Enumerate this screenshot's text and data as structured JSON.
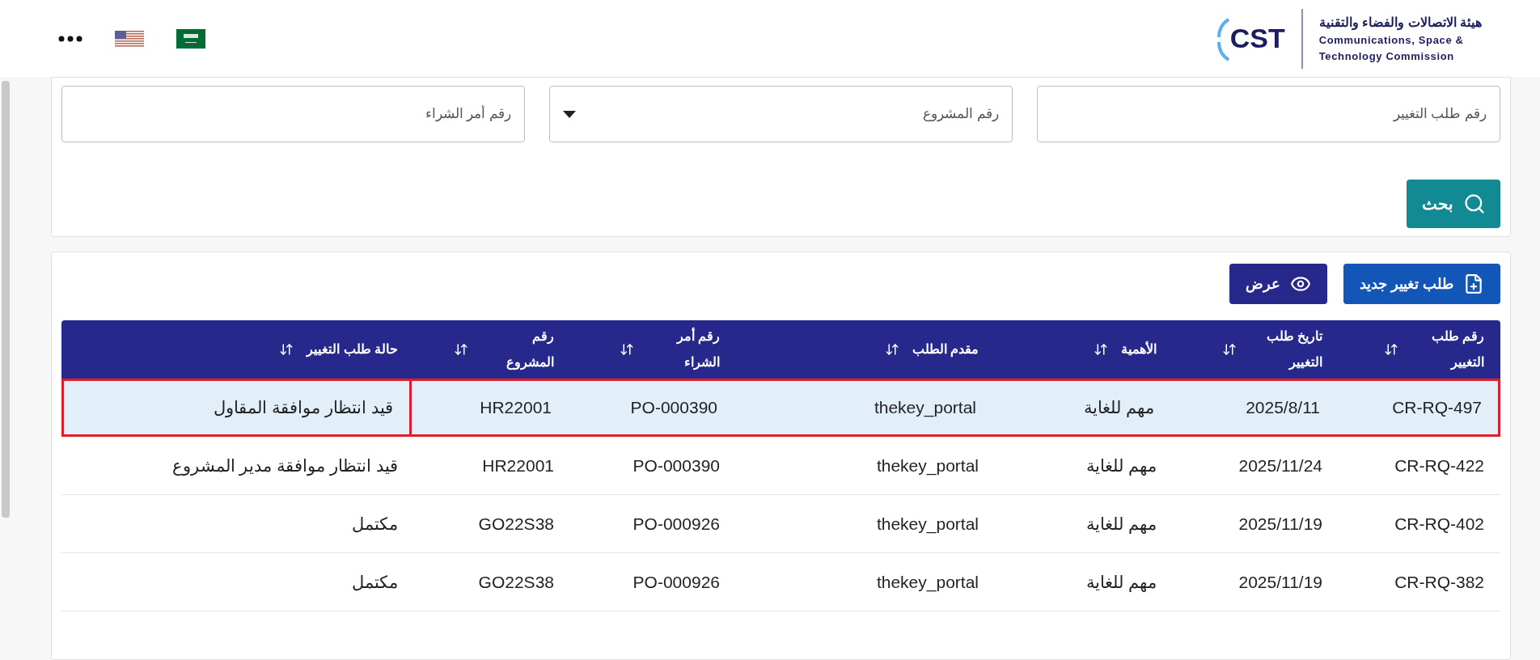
{
  "header": {
    "logo": {
      "mark": "CST",
      "name_ar": "هيئة الاتصالات والفضاء والتقنية",
      "name_en_1": "Communications, Space &",
      "name_en_2": "Technology Commission"
    }
  },
  "filters": [
    {
      "kind": "text",
      "placeholder": "رقم طلب التغيير"
    },
    {
      "kind": "select",
      "placeholder": "رقم المشروع"
    },
    {
      "kind": "text",
      "placeholder": "رقم أمر الشراء"
    }
  ],
  "search_button": "بحث",
  "actions": [
    {
      "kind": "new",
      "label": "طلب تغيير جديد"
    },
    {
      "kind": "view",
      "label": "عرض"
    }
  ],
  "table": {
    "columns": [
      "رقم طلب التغيير",
      "تاريخ طلب التغيير",
      "الأهمية",
      "مقدم الطلب",
      "رقم أمر الشراء",
      "رقم المشروع",
      "حالة طلب التغيير"
    ],
    "rows": [
      {
        "selected": true,
        "cells": [
          "CR-RQ-497",
          "2025/8/11",
          "مهم للغاية",
          "thekey_portal",
          "PO-000390",
          "HR22001",
          "قيد انتظار موافقة المقاول"
        ]
      },
      {
        "selected": false,
        "cells": [
          "CR-RQ-422",
          "2025/11/24",
          "مهم للغاية",
          "thekey_portal",
          "PO-000390",
          "HR22001",
          "قيد انتظار موافقة مدير المشروع"
        ]
      },
      {
        "selected": false,
        "cells": [
          "CR-RQ-402",
          "2025/11/19",
          "مهم للغاية",
          "thekey_portal",
          "PO-000926",
          "GO22S38",
          "مكتمل"
        ]
      },
      {
        "selected": false,
        "cells": [
          "CR-RQ-382",
          "2025/11/19",
          "مهم للغاية",
          "thekey_portal",
          "PO-000926",
          "GO22S38",
          "مكتمل"
        ]
      }
    ]
  }
}
